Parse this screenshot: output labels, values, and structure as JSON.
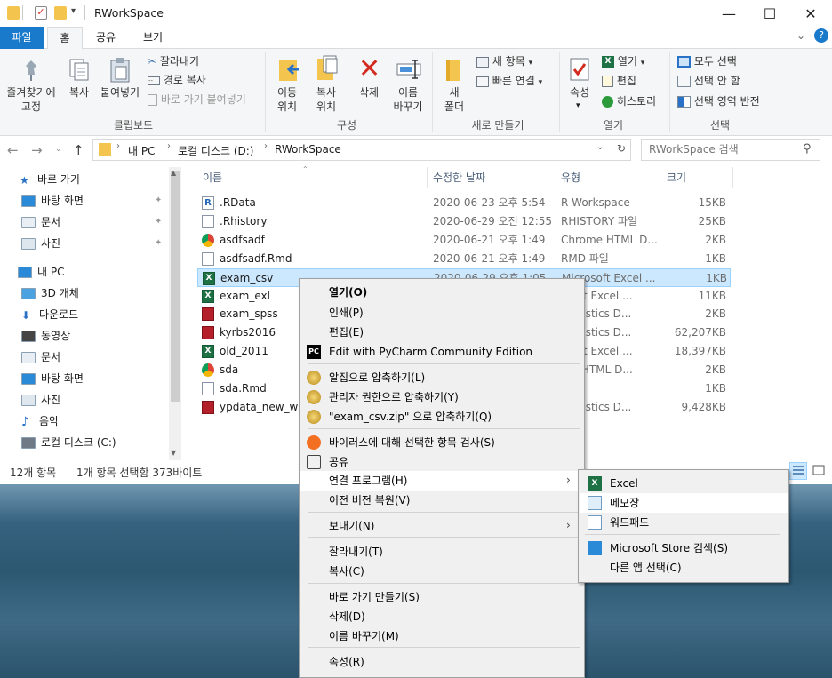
{
  "window": {
    "title": "RWorkSpace",
    "tabs": [
      "파일",
      "홈",
      "공유",
      "보기"
    ]
  },
  "ribbon": {
    "clipboard": {
      "pin_label": "즐겨찾기에\n고정",
      "copy_label": "복사",
      "paste_label": "붙여넣기",
      "cut_label": "잘라내기",
      "copy_path_label": "경로 복사",
      "paste_shortcut_label": "바로 가기 붙여넣기",
      "group_label": "클립보드"
    },
    "organize": {
      "move_label": "이동\n위치",
      "copy_to_label": "복사\n위치",
      "delete_label": "삭제",
      "rename_label": "이름\n바꾸기",
      "group_label": "구성"
    },
    "new": {
      "new_folder_label": "새\n폴더",
      "new_item_label": "새 항목",
      "easy_access_label": "빠른 연결",
      "group_label": "새로 만들기"
    },
    "open": {
      "properties_label": "속성",
      "open_label": "열기",
      "edit_label": "편집",
      "history_label": "히스토리",
      "group_label": "열기"
    },
    "select": {
      "select_all_label": "모두 선택",
      "select_none_label": "선택 안 함",
      "invert_label": "선택 영역 반전",
      "group_label": "선택"
    }
  },
  "address": {
    "path": [
      "내 PC",
      "로컬 디스크 (D:)",
      "RWorkSpace"
    ],
    "search_placeholder": "RWorkSpace 검색"
  },
  "nav_pane": {
    "items": [
      {
        "label": "바로 가기",
        "icon": "star-icon",
        "pinned": false
      },
      {
        "label": "바탕 화면",
        "icon": "desktop-icon",
        "pinned": true
      },
      {
        "label": "문서",
        "icon": "document-icon",
        "pinned": true
      },
      {
        "label": "사진",
        "icon": "pictures-icon",
        "pinned": true
      },
      {
        "label": "내 PC",
        "icon": "pc-icon",
        "pinned": false
      },
      {
        "label": "3D 개체",
        "icon": "3d-objects-icon",
        "pinned": false
      },
      {
        "label": "다운로드",
        "icon": "download-icon",
        "pinned": false
      },
      {
        "label": "동영상",
        "icon": "video-icon",
        "pinned": false
      },
      {
        "label": "문서",
        "icon": "document-icon",
        "pinned": false
      },
      {
        "label": "바탕 화면",
        "icon": "desktop-icon",
        "pinned": false
      },
      {
        "label": "사진",
        "icon": "pictures-icon",
        "pinned": false
      },
      {
        "label": "음악",
        "icon": "music-icon",
        "pinned": false
      },
      {
        "label": "로컬 디스크 (C:)",
        "icon": "drive-icon",
        "pinned": false
      }
    ]
  },
  "file_list": {
    "columns": [
      "이름",
      "수정한 날짜",
      "유형",
      "크기"
    ],
    "files": [
      {
        "name": ".RData",
        "date": "2020-06-23 오후 5:54",
        "type": "R Workspace",
        "size": "15KB",
        "icon": "r-file-icon"
      },
      {
        "name": ".Rhistory",
        "date": "2020-06-29 오전 12:55",
        "type": "RHISTORY 파일",
        "size": "25KB",
        "icon": "blank-file-icon"
      },
      {
        "name": "asdfsadf",
        "date": "2020-06-21 오후 1:49",
        "type": "Chrome HTML D...",
        "size": "2KB",
        "icon": "chrome-file-icon"
      },
      {
        "name": "asdfsadf.Rmd",
        "date": "2020-06-21 오후 1:49",
        "type": "RMD 파일",
        "size": "1KB",
        "icon": "blank-file-icon"
      },
      {
        "name": "exam_csv",
        "date": "2020-06-29 오후 1:05",
        "type": "Microsoft Excel ...",
        "size": "1KB",
        "icon": "excel-file-icon"
      },
      {
        "name": "exam_exl",
        "date": "",
        "type": "osoft Excel ...",
        "size": "11KB",
        "icon": "excel-file-icon"
      },
      {
        "name": "exam_spss",
        "date": "",
        "type": "Statistics D...",
        "size": "2KB",
        "icon": "spss-file-icon"
      },
      {
        "name": "kyrbs2016",
        "date": "",
        "type": "Statistics D...",
        "size": "62,207KB",
        "icon": "spss-file-icon"
      },
      {
        "name": "old_2011",
        "date": "",
        "type": "osoft Excel ...",
        "size": "18,397KB",
        "icon": "excel-file-icon"
      },
      {
        "name": "sda",
        "date": "",
        "type": "me HTML D...",
        "size": "2KB",
        "icon": "chrome-file-icon"
      },
      {
        "name": "sda.Rmd",
        "date": "",
        "type": "파일",
        "size": "1KB",
        "icon": "blank-file-icon"
      },
      {
        "name": "ypdata_new_w10",
        "date": "",
        "type": "Statistics D...",
        "size": "9,428KB",
        "icon": "spss-file-icon"
      }
    ]
  },
  "status": {
    "item_count": "12개 항목",
    "selection": "1개 항목 선택함 373바이트"
  },
  "context_menu": {
    "items": [
      {
        "label": "열기(O)",
        "bold": true
      },
      {
        "label": "인쇄(P)"
      },
      {
        "label": "편집(E)"
      },
      {
        "label": "Edit with PyCharm Community Edition",
        "icon": "pycharm-icon"
      },
      {
        "label": "알집으로 압축하기(L)",
        "icon": "alzip-icon"
      },
      {
        "label": "관리자 권한으로 압축하기(Y)",
        "icon": "alzip-icon"
      },
      {
        "label": "\"exam_csv.zip\" 으로 압축하기(Q)",
        "icon": "alzip-icon"
      },
      {
        "label": "바이러스에 대해 선택한 항목 검사(S)",
        "icon": "avast-icon"
      },
      {
        "label": "공유",
        "icon": "share-icon"
      },
      {
        "label": "연결 프로그램(H)",
        "submenu": true
      },
      {
        "label": "이전 버전 복원(V)"
      },
      {
        "label": "보내기(N)",
        "submenu": true
      },
      {
        "label": "잘라내기(T)"
      },
      {
        "label": "복사(C)"
      },
      {
        "label": "바로 가기 만들기(S)"
      },
      {
        "label": "삭제(D)"
      },
      {
        "label": "이름 바꾸기(M)"
      },
      {
        "label": "속성(R)"
      }
    ]
  },
  "open_with_menu": {
    "items": [
      {
        "label": "Excel",
        "icon": "excel-icon"
      },
      {
        "label": "메모장",
        "icon": "notepad-icon"
      },
      {
        "label": "워드패드",
        "icon": "wordpad-icon"
      },
      {
        "label": "Microsoft Store 검색(S)",
        "icon": "store-icon"
      },
      {
        "label": "다른 앱 선택(C)"
      }
    ]
  },
  "colors": {
    "accent": "#1979ca",
    "selection_bg": "#cce8ff",
    "selection_border": "#99d1ff",
    "excel_green": "#1e7145"
  }
}
